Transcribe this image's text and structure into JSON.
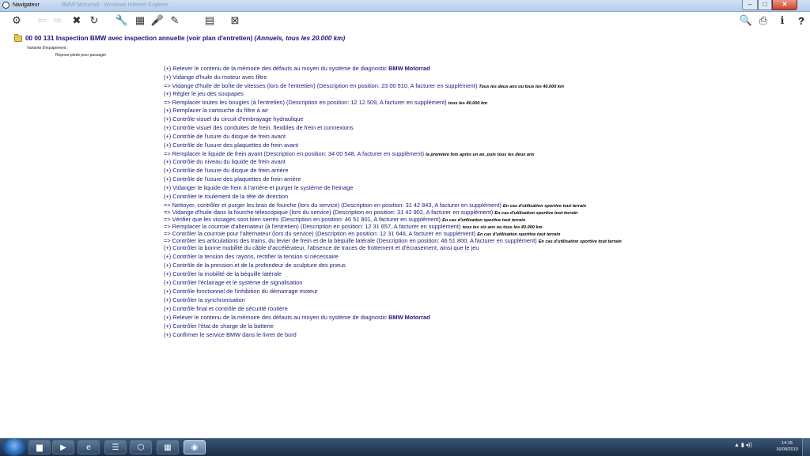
{
  "window": {
    "title": "Navigateur",
    "ghost_title": "BMW Motorrad - Windows Internet Explorer",
    "controls": {
      "minimize": "–",
      "maximize": "□",
      "close": "✕"
    }
  },
  "toolbar": {
    "tools": [
      {
        "icon": "hierarchy-icon",
        "glyph": "⚙"
      },
      {
        "icon": "back-arrow-icon",
        "glyph": "⇦"
      },
      {
        "icon": "forward-arrow-icon",
        "glyph": "⇨"
      },
      {
        "icon": "close-circle-icon",
        "glyph": "✖"
      },
      {
        "icon": "refresh-icon",
        "glyph": "↻"
      },
      {
        "icon": "wrench-icon",
        "glyph": "🔧"
      },
      {
        "icon": "table-icon",
        "glyph": "▦"
      },
      {
        "icon": "microphone-icon",
        "glyph": "🎤"
      },
      {
        "icon": "tools-icon",
        "glyph": "✎"
      },
      {
        "icon": "document-stack-icon",
        "glyph": "▤"
      },
      {
        "icon": "filter-icon",
        "glyph": "⊠"
      }
    ],
    "right_tools": [
      {
        "icon": "search-icon",
        "glyph": "🔍"
      },
      {
        "icon": "print-icon",
        "glyph": "⎙"
      },
      {
        "icon": "info-icon",
        "glyph": "ℹ"
      },
      {
        "icon": "help-icon",
        "glyph": "?"
      }
    ]
  },
  "document": {
    "heading": "00 00 131 Inspection BMW avec inspection annuelle (voir plan d'entretien)",
    "heading_note": "(Annuels, tous les 20.000 km)",
    "variant_label": "Variante d'équipement :",
    "variant_value": "Repose-pieds pour passager",
    "steps": [
      {
        "text": "(+) Relever le contenu de la mémoire des défauts au moyen du système de diagnostic ",
        "brand": "BMW Motorrad",
        "note": ""
      },
      {
        "text": "(+) Vidange d'huile du moteur avec filtre",
        "brand": "",
        "note": ""
      },
      {
        "text": "=> Vidange d'huile de boîte de vitesses (lors de l'entretien) (Description en position: 23 00 510, A facturer en supplément)",
        "brand": "",
        "note": "Tous les deux ans ou tous les 40.000 km"
      },
      {
        "text": "(+) Régler le jeu des soupapes",
        "brand": "",
        "note": ""
      },
      {
        "text": "=> Remplacer toutes les bougies (à l'entretien) (Description en position: 12 12 509, A facturer en supplément)",
        "brand": "",
        "note": "tous les 40.000 km"
      },
      {
        "text": "(+) Remplacer la cartouche du filtre à air",
        "brand": "",
        "note": ""
      },
      {
        "text": "(+) Contrôle visuel du circuit d'embrayage hydraulique",
        "brand": "",
        "note": ""
      },
      {
        "text": "(+) Contrôle visuel des conduites de frein, flexibles de frein et connexions",
        "brand": "",
        "note": ""
      },
      {
        "text": "(+) Contrôle de l'usure du disque de frein avant",
        "brand": "",
        "note": ""
      },
      {
        "text": "(+) Contrôle de l'usure des plaquettes de frein avant",
        "brand": "",
        "note": ""
      },
      {
        "text": "=> Remplacer le liquide de frein avant (Description en position: 34 00 548, A facturer en supplément)",
        "brand": "",
        "note": "la première fois après un an, puis tous les deux ans"
      },
      {
        "text": "(+) Contrôle du niveau du liquide de frein avant",
        "brand": "",
        "note": ""
      },
      {
        "text": "(+) Contrôle de l'usure du disque de frein arrière",
        "brand": "",
        "note": ""
      },
      {
        "text": "(+) Contrôle de l'usure des plaquettes de frein arrière",
        "brand": "",
        "note": ""
      },
      {
        "text": "(+) Vidanger le liquide de frein à l'arrière et purger le système de freinage",
        "brand": "",
        "note": ""
      },
      {
        "text": "(+) Contrôler le roulement de la tête de direction",
        "brand": "",
        "note": ""
      },
      {
        "text": "=> Nettoyer, contrôler et purger les bras de fourche (lors du service) (Description en position: 31 42 843, A facturer en supplément)",
        "brand": "",
        "note": "En cas d'utilisation sportive tout terrain"
      },
      {
        "text": "=> Vidange d'huile dans la fourche télescopique (lors du service) (Description en position: 31 42 902, A facturer en supplément)",
        "brand": "",
        "note": "En cas d'utilisation sportive tout terrain"
      },
      {
        "text": "=> Vérifier que les vissages sont bien serrés (Description en position: 46 51 801, A facturer en supplément)",
        "brand": "",
        "note": "En cas d'utilisation sportive tout terrain"
      },
      {
        "text": "=> Remplacer la courroie d'alternateur (à l'entretien) (Description en position: 12 31 657, A facturer en supplément)",
        "brand": "",
        "note": "tous les six ans ou tous les 40.000 km"
      },
      {
        "text": "=> Contrôler la courroie pour l'alternateur (lors du service) (Description en position: 12 31 646, A facturer en supplément)",
        "brand": "",
        "note": "En cas d'utilisation sportive tout terrain"
      },
      {
        "text": "=> Contrôler les articulations des trains, du levier de frein et de la béquille latérale (Description en position: 46 51 800, A facturer en supplément)",
        "brand": "",
        "note": "En cas d'utilisation sportive tout terrain"
      },
      {
        "text": "(+) Contrôler la bonne mobilité du câble d'accélérateur, l'absence de traces de frottement et d'écrasement, ainsi que le jeu",
        "brand": "",
        "note": ""
      },
      {
        "text": "(+) Contrôler la tension des rayons, rectifier la tension si nécessaire",
        "brand": "",
        "note": ""
      },
      {
        "text": "(+) Contrôle de la pression et de la profondeur de sculpture des pneus",
        "brand": "",
        "note": ""
      },
      {
        "text": "(+) Contrôler la mobilité de la béquille latérale",
        "brand": "",
        "note": ""
      },
      {
        "text": "(+) Contrôler l'éclairage et le système de signalisation",
        "brand": "",
        "note": ""
      },
      {
        "text": "(+) Contrôle fonctionnel de l'inhibition du démarrage moteur",
        "brand": "",
        "note": ""
      },
      {
        "text": "(+) Contrôler la synchronisation",
        "brand": "",
        "note": ""
      },
      {
        "text": "(+) Contrôle final et contrôle de sécurité routière",
        "brand": "",
        "note": ""
      },
      {
        "text": "(+) Relever le contenu de la mémoire des défauts au moyen du système de diagnostic ",
        "brand": "BMW Motorrad",
        "note": ""
      },
      {
        "text": "(+) Contrôler l'état de charge de la batterie",
        "brand": "",
        "note": ""
      },
      {
        "text": "(+) Confirmer le service BMW dans le livret de bord",
        "brand": "",
        "note": ""
      }
    ]
  },
  "taskbar": {
    "apps": [
      {
        "icon": "explorer-folder-icon",
        "glyph": "▆"
      },
      {
        "icon": "media-player-icon",
        "glyph": "▶"
      },
      {
        "icon": "internet-explorer-icon",
        "glyph": "e"
      },
      {
        "icon": "list-window-icon",
        "glyph": "☰"
      },
      {
        "icon": "network-icon",
        "glyph": "⬡"
      },
      {
        "icon": "folder-app-icon",
        "glyph": "▦"
      },
      {
        "icon": "bmw-app-icon",
        "glyph": "◉"
      }
    ],
    "tray": "▲ ▮ ◂))",
    "time": "14:15",
    "date": "16/09/2010"
  }
}
